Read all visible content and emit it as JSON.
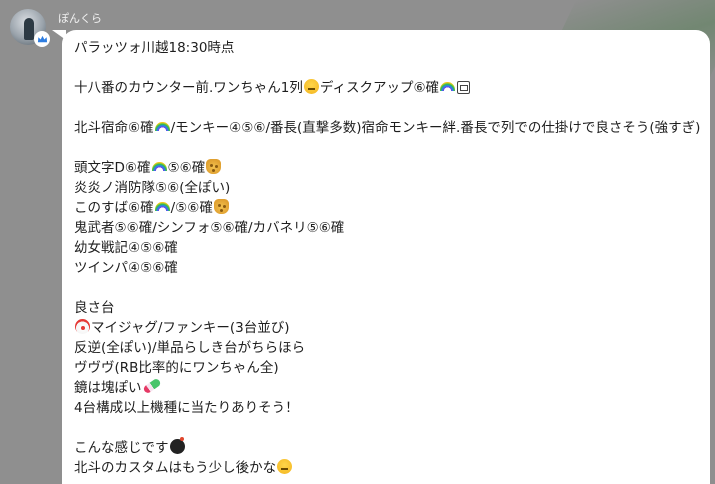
{
  "chat": {
    "sender_name": "ぽんくら",
    "lines": [
      {
        "text": "パラッツォ川越18:30時点"
      },
      {
        "text": ""
      },
      {
        "text": "十八番のカウンター前.ワンちゃん1列",
        "emojis": [
          "thinking-face-emoji"
        ],
        "tail": "ディスクアップ⑥確",
        "emojis2": [
          "rainbow-emoji",
          "box-emoji"
        ]
      },
      {
        "text": ""
      },
      {
        "text": "北斗宿命⑥確",
        "emojis": [
          "rainbow-emoji"
        ],
        "tail": "/モンキー④⑤⑥/番長(直撃多数)宿命モンキー絆.番長で列での仕掛けで良さそう(強すぎ)"
      },
      {
        "text": ""
      },
      {
        "text": "頭文字D⑥確",
        "emojis": [
          "rainbow-emoji"
        ],
        "tail": "⑤⑥確",
        "emojis2": [
          "giraffe-emoji"
        ]
      },
      {
        "text": "炎炎ノ消防隊⑤⑥(全ぽい)"
      },
      {
        "text": "このすば⑥確",
        "emojis": [
          "rainbow-emoji"
        ],
        "tail": "/⑤⑥確",
        "emojis2": [
          "giraffe-emoji"
        ]
      },
      {
        "text": "鬼武者⑤⑥確/シンフォ⑤⑥確/カバネリ⑤⑥確"
      },
      {
        "text": "幼女戦記④⑤⑥確"
      },
      {
        "text": "ツインパ④⑤⑥確"
      },
      {
        "text": ""
      },
      {
        "text": "良さ台"
      },
      {
        "lead_emojis": [
          "clown-emoji"
        ],
        "text": "マイジャグ/ファンキー(3台並び)"
      },
      {
        "text": "反逆(全ぽい)/単品らしき台がちらほら"
      },
      {
        "text": "ヴヴヴ(RB比率的にワンちゃん全)"
      },
      {
        "text": "鏡は塊ぽい",
        "emojis": [
          "candy-emoji"
        ]
      },
      {
        "text": "4台構成以上機種に当たりありそう！"
      },
      {
        "text": ""
      },
      {
        "text": "こんな感じです",
        "emojis": [
          "bomb-emoji"
        ]
      },
      {
        "text": "北斗のカスタムはもう少し後かな",
        "emojis": [
          "thinking-face-emoji"
        ]
      }
    ]
  },
  "icons": {
    "avatar": "user-avatar",
    "badge": "crown-icon"
  },
  "colors": {
    "background": "#8f8f8f",
    "bubble": "#ffffff",
    "text": "#1e1e1e",
    "badge_icon": "#2e7de0"
  }
}
